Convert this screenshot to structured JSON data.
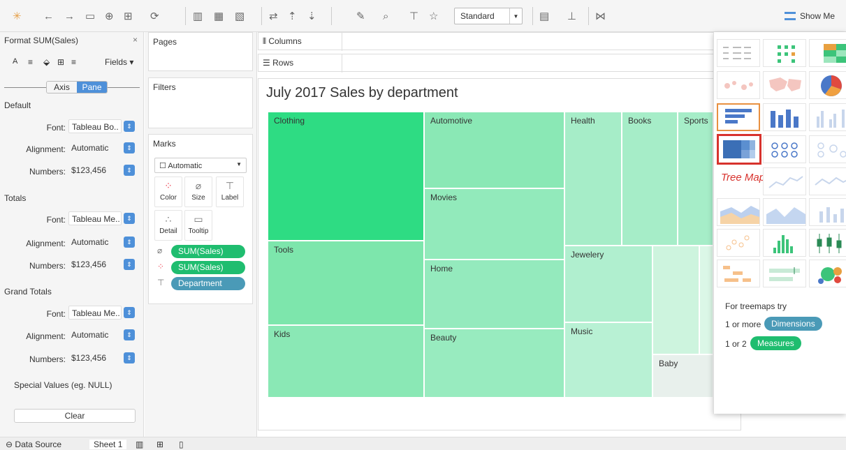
{
  "toolbar": {
    "fit_select": "Standard",
    "show_me": "Show Me"
  },
  "format_pane": {
    "title": "Format SUM(Sales)",
    "fields": "Fields",
    "tabs": {
      "axis": "Axis",
      "pane": "Pane"
    },
    "default": {
      "heading": "Default",
      "font_label": "Font:",
      "font": "Tableau Bo..",
      "alignment_label": "Alignment:",
      "alignment": "Automatic",
      "numbers_label": "Numbers:",
      "numbers": "$123,456"
    },
    "totals": {
      "heading": "Totals",
      "font_label": "Font:",
      "font": "Tableau Me..",
      "alignment_label": "Alignment:",
      "alignment": "Automatic",
      "numbers_label": "Numbers:",
      "numbers": "$123,456"
    },
    "grand_totals": {
      "heading": "Grand Totals",
      "font_label": "Font:",
      "font": "Tableau Me..",
      "alignment_label": "Alignment:",
      "alignment": "Automatic",
      "numbers_label": "Numbers:",
      "numbers": "$123,456"
    },
    "special_values": "Special Values (eg. NULL)",
    "clear": "Clear"
  },
  "cards": {
    "pages": "Pages",
    "filters": "Filters",
    "marks": "Marks",
    "mark_type": "Automatic"
  },
  "marks_buttons": {
    "color": "Color",
    "size": "Size",
    "label": "Label",
    "detail": "Detail",
    "tooltip": "Tooltip"
  },
  "mark_pills": [
    "SUM(Sales)",
    "SUM(Sales)",
    "Department"
  ],
  "shelves": {
    "columns": "Columns",
    "rows": "Rows"
  },
  "viz": {
    "title": "July 2017 Sales by department",
    "tiles": [
      "Clothing",
      "Automotive",
      "Health",
      "Books",
      "Sports",
      "Movies",
      "Tools",
      "Home",
      "Jewelery",
      "Kids",
      "Beauty",
      "Music",
      "Baby"
    ]
  },
  "show_me": {
    "tree_map_label": "Tree Map",
    "hint_title": "For treemaps try",
    "dims_prefix": "1 or more",
    "dims": "Dimensions",
    "meas_prefix": "1 or 2",
    "meas": "Measures"
  },
  "statusbar": {
    "data_source": "Data Source",
    "sheet": "Sheet 1"
  },
  "colors": {
    "accent": "#4e90d9",
    "measure_pill": "#1fbd6f",
    "dimension_pill": "#4a9ab7",
    "highlight": "#d7322d"
  }
}
